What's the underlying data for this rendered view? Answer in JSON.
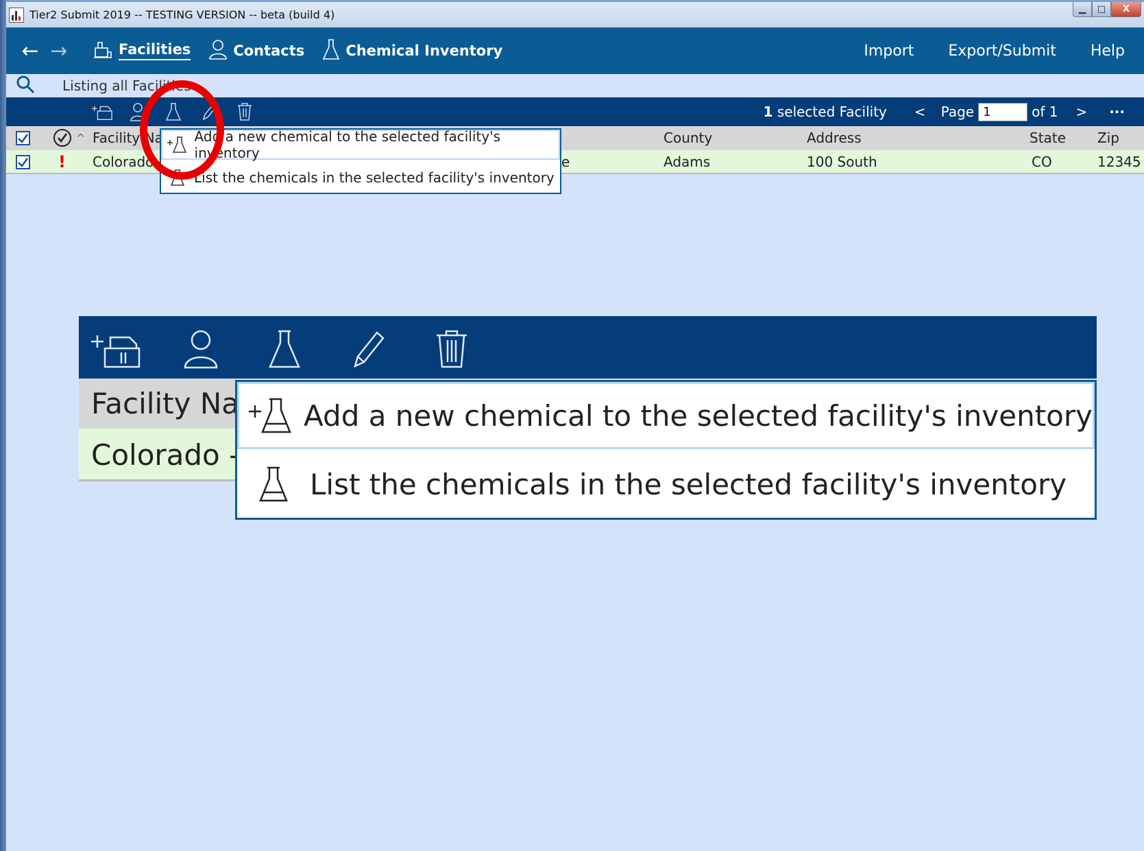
{
  "window": {
    "title": "Tier2 Submit 2019 -- TESTING VERSION -- beta (build 4)",
    "min_glyph": "▁",
    "max_glyph": "□",
    "close_glyph": "X"
  },
  "nav": {
    "back": "←",
    "forward": "→",
    "items": [
      {
        "label": "Facilities",
        "icon": "facility-icon",
        "active": true
      },
      {
        "label": "Contacts",
        "icon": "person-icon",
        "active": false
      },
      {
        "label": "Chemical Inventory",
        "icon": "flask-icon",
        "active": false
      }
    ],
    "right": [
      "Import",
      "Export/Submit",
      "Help"
    ]
  },
  "search": {
    "text": "Listing all Facilities"
  },
  "toolbar": {
    "icons": [
      "add-facility-icon",
      "person-icon",
      "flask-icon",
      "pencil-icon",
      "trash-icon"
    ],
    "selected_count": "1",
    "selected_label": " selected Facility",
    "prev": "<",
    "page_label": "Page",
    "page_value": "1",
    "of_label": "of 1",
    "next": ">",
    "more": "···"
  },
  "table": {
    "headers": {
      "status_icon": "check-circle-icon",
      "sort_glyph": "^",
      "facility_name": "Facility Na",
      "county": "County",
      "address": "Address",
      "state": "State",
      "zip": "Zip"
    },
    "rows": [
      {
        "checked": true,
        "alert": "!",
        "facility_name": "Colorado",
        "hidden_tail": "e",
        "county": "Adams",
        "address": "100 South",
        "state": "CO",
        "zip": "12345"
      }
    ]
  },
  "dropdown": {
    "items": [
      {
        "label": "Add a new chemical to the selected facility's inventory",
        "icon": "add-flask-icon"
      },
      {
        "label": "List the chemicals in the selected facility's inventory",
        "icon": "flask-icon"
      }
    ]
  },
  "zoom": {
    "header_text": "Facility Na",
    "row_text": "Colorado -",
    "items": [
      {
        "label": "Add a new chemical to the selected facility's inventory"
      },
      {
        "label": "List the chemicals in the selected facility's inventory"
      }
    ]
  },
  "colors": {
    "nav_bg": "#0b5b95",
    "toolbar_bg": "#053c7a",
    "page_bg": "#d4e3fa",
    "row_bg": "#e3f7db",
    "annotation": "#e80000"
  }
}
